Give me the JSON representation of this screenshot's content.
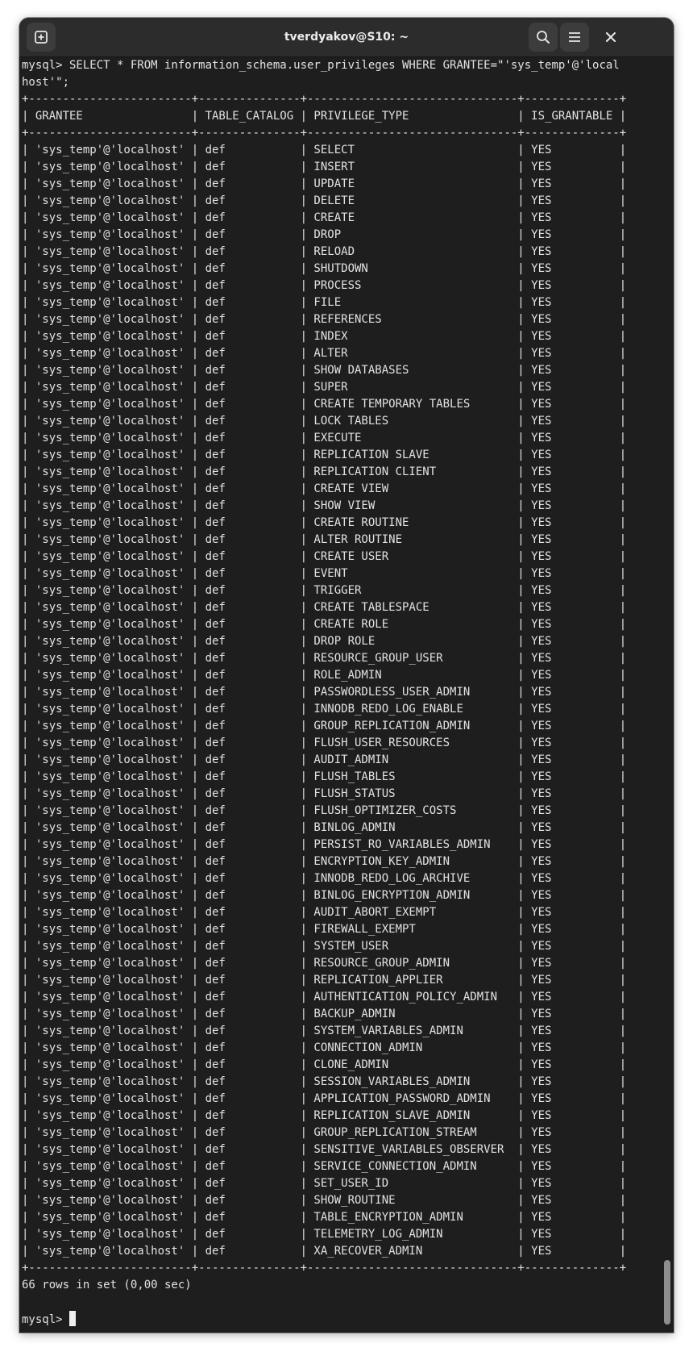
{
  "window": {
    "title": "tverdyakov@S10: ~"
  },
  "icons": {
    "new_tab": "new-tab-icon",
    "search": "search-icon",
    "menu": "hamburger-menu-icon",
    "close": "close-icon"
  },
  "terminal": {
    "command_line_1": "mysql> SELECT * FROM information_schema.user_privileges WHERE GRANTEE=\"'sys_temp'@'local",
    "command_line_2": "host'\";",
    "columns": [
      "GRANTEE",
      "TABLE_CATALOG",
      "PRIVILEGE_TYPE",
      "IS_GRANTABLE"
    ],
    "grantee": "'sys_temp'@'localhost'",
    "table_catalog": "def",
    "is_grantable": "YES",
    "privileges": [
      "SELECT",
      "INSERT",
      "UPDATE",
      "DELETE",
      "CREATE",
      "DROP",
      "RELOAD",
      "SHUTDOWN",
      "PROCESS",
      "FILE",
      "REFERENCES",
      "INDEX",
      "ALTER",
      "SHOW DATABASES",
      "SUPER",
      "CREATE TEMPORARY TABLES",
      "LOCK TABLES",
      "EXECUTE",
      "REPLICATION SLAVE",
      "REPLICATION CLIENT",
      "CREATE VIEW",
      "SHOW VIEW",
      "CREATE ROUTINE",
      "ALTER ROUTINE",
      "CREATE USER",
      "EVENT",
      "TRIGGER",
      "CREATE TABLESPACE",
      "CREATE ROLE",
      "DROP ROLE",
      "RESOURCE_GROUP_USER",
      "ROLE_ADMIN",
      "PASSWORDLESS_USER_ADMIN",
      "INNODB_REDO_LOG_ENABLE",
      "GROUP_REPLICATION_ADMIN",
      "FLUSH_USER_RESOURCES",
      "AUDIT_ADMIN",
      "FLUSH_TABLES",
      "FLUSH_STATUS",
      "FLUSH_OPTIMIZER_COSTS",
      "BINLOG_ADMIN",
      "PERSIST_RO_VARIABLES_ADMIN",
      "ENCRYPTION_KEY_ADMIN",
      "INNODB_REDO_LOG_ARCHIVE",
      "BINLOG_ENCRYPTION_ADMIN",
      "AUDIT_ABORT_EXEMPT",
      "FIREWALL_EXEMPT",
      "SYSTEM_USER",
      "RESOURCE_GROUP_ADMIN",
      "REPLICATION_APPLIER",
      "AUTHENTICATION_POLICY_ADMIN",
      "BACKUP_ADMIN",
      "SYSTEM_VARIABLES_ADMIN",
      "CONNECTION_ADMIN",
      "CLONE_ADMIN",
      "SESSION_VARIABLES_ADMIN",
      "APPLICATION_PASSWORD_ADMIN",
      "REPLICATION_SLAVE_ADMIN",
      "GROUP_REPLICATION_STREAM",
      "SENSITIVE_VARIABLES_OBSERVER",
      "SERVICE_CONNECTION_ADMIN",
      "SET_USER_ID",
      "SHOW_ROUTINE",
      "TABLE_ENCRYPTION_ADMIN",
      "TELEMETRY_LOG_ADMIN",
      "XA_RECOVER_ADMIN"
    ],
    "summary": "66 rows in set (0,00 sec)",
    "prompt": "mysql> "
  },
  "colors": {
    "terminal_bg": "#1e1e1e",
    "titlebar_bg": "#2c2c2c",
    "text": "#e2e2e2"
  }
}
